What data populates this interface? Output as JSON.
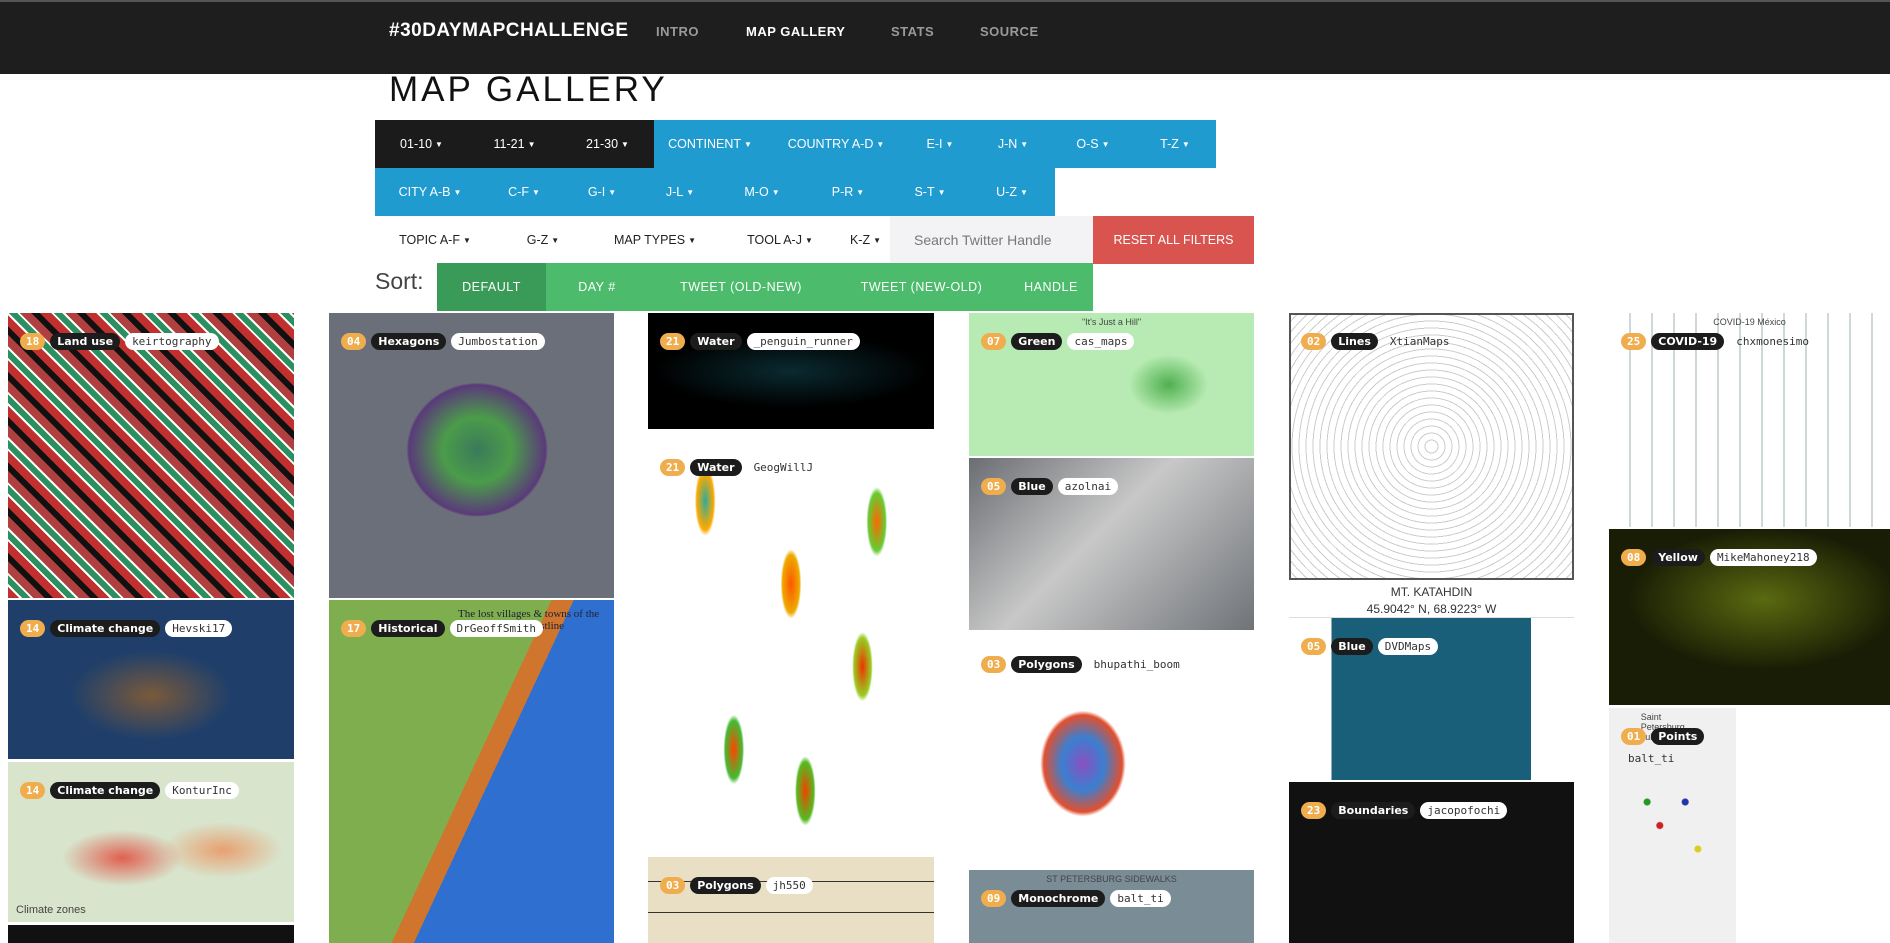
{
  "nav": {
    "brand": "#30DAYMAPCHALLENGE",
    "links": [
      "INTRO",
      "MAP GALLERY",
      "STATS",
      "SOURCE"
    ],
    "active": "MAP GALLERY"
  },
  "page_title": "MAP GALLERY",
  "filters": {
    "days": [
      "01-10",
      "11-21",
      "21-30"
    ],
    "country": [
      "CONTINENT",
      "COUNTRY A-D",
      "E-I",
      "J-N",
      "O-S",
      "T-Z"
    ],
    "city": [
      "CITY A-B",
      "C-F",
      "G-I",
      "J-L",
      "M-O",
      "P-R",
      "S-T",
      "U-Z"
    ],
    "topic": [
      "TOPIC A-F",
      "G-Z",
      "MAP TYPES",
      "TOOL A-J",
      "K-Z"
    ],
    "search_placeholder": "Search Twitter Handle",
    "reset": "RESET ALL FILTERS"
  },
  "sort": {
    "label": "Sort:",
    "options": [
      "DEFAULT",
      "DAY #",
      "TWEET (OLD-NEW)",
      "TWEET (NEW-OLD)",
      "HANDLE"
    ],
    "active": "DEFAULT"
  },
  "colors": {
    "nav": "#1e1e1e",
    "filter_blue": "#1f9bd0",
    "reset_red": "#d9534f",
    "sort_green": "#4cbb6c",
    "day_badge": "#f0ad4e"
  },
  "tiles": [
    {
      "day": "18",
      "topic": "Land use",
      "handle": "keirtography",
      "pill": true
    },
    {
      "day": "14",
      "topic": "Climate change",
      "handle": "Hevski17",
      "pill": true
    },
    {
      "day": "14",
      "topic": "Climate change",
      "handle": "KonturInc",
      "pill": true,
      "image_text": "Climate zones"
    },
    {
      "day": "",
      "topic": "",
      "handle": ""
    },
    {
      "day": "04",
      "topic": "Hexagons",
      "handle": "Jumbostation",
      "pill": true
    },
    {
      "day": "17",
      "topic": "Historical",
      "handle": "DrGeoffSmith",
      "pill": true,
      "image_text": "The lost villages & towns of the East Yorkshire coastline"
    },
    {
      "day": "21",
      "topic": "Water",
      "handle": "_penguin_runner",
      "pill": true
    },
    {
      "day": "21",
      "topic": "Water",
      "handle": "GeogWillJ",
      "pill": false
    },
    {
      "day": "03",
      "topic": "Polygons",
      "handle": "jh550",
      "pill": true
    },
    {
      "day": "07",
      "topic": "Green",
      "handle": "cas_maps",
      "pill": true,
      "image_text": "\"It's Just a Hill\""
    },
    {
      "day": "05",
      "topic": "Blue",
      "handle": "azolnai",
      "pill": true
    },
    {
      "day": "03",
      "topic": "Polygons",
      "handle": "bhupathi_boom",
      "pill": false
    },
    {
      "day": "09",
      "topic": "Monochrome",
      "handle": "balt_ti",
      "pill": true,
      "image_text": "ST PETERSBURG SIDEWALKS"
    },
    {
      "day": "02",
      "topic": "Lines",
      "handle": "XtianMaps",
      "pill": false,
      "caption": [
        "MT. KATAHDIN",
        "45.9042° N, 68.9223° W"
      ]
    },
    {
      "day": "05",
      "topic": "Blue",
      "handle": "DVDMaps",
      "pill": true
    },
    {
      "day": "23",
      "topic": "Boundaries",
      "handle": "jacopofochi",
      "pill": true
    },
    {
      "day": "25",
      "topic": "COVID-19",
      "handle": "chxmonesimo",
      "pill": false,
      "image_text": "COVID-19 México"
    },
    {
      "day": "08",
      "topic": "Yellow",
      "handle": "MikeMahoney218",
      "pill": true
    },
    {
      "day": "01",
      "topic": "Points",
      "handle": "balt_ti",
      "pill": false,
      "image_text": "Saint Petersburg subway"
    }
  ]
}
